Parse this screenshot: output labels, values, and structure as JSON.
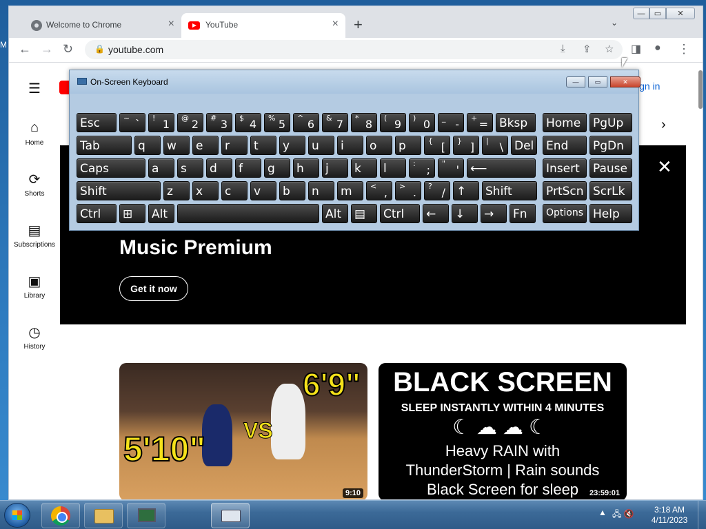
{
  "desktop": {
    "edge_text": "M"
  },
  "browser": {
    "tabs": [
      {
        "label": "Welcome to Chrome",
        "close": "×"
      },
      {
        "label": "YouTube",
        "close": "×"
      }
    ],
    "new_tab": "+",
    "tab_search": "⌄",
    "window_controls": {
      "min": "—",
      "max": "▭",
      "close": "✕"
    },
    "nav": {
      "back": "←",
      "forward": "→",
      "reload": "↻"
    },
    "address": {
      "lock": "🔒",
      "url": "youtube.com"
    },
    "omni_icons": {
      "install": "⤓",
      "share": "⇪",
      "bookmark": "☆"
    },
    "toolbar_icons": {
      "side_panel": "◨",
      "profile": "●",
      "menu": "⋮"
    }
  },
  "youtube": {
    "menu_icon": "☰",
    "sidebar": [
      {
        "icon": "⌂",
        "label": "Home"
      },
      {
        "icon": "⟳",
        "label": "Shorts"
      },
      {
        "icon": "▤",
        "label": "Subscriptions"
      },
      {
        "icon": "▣",
        "label": "Library"
      },
      {
        "icon": "◷",
        "label": "History"
      }
    ],
    "sign_in": "ign in",
    "chevron_right": "›",
    "banner": {
      "close": "✕",
      "title": "Music Premium",
      "button": "Get it now"
    },
    "videos": [
      {
        "duration": "9:10",
        "text_top": "6'9\"",
        "text_bottom": "5'10\"",
        "text_vs": "VS"
      },
      {
        "duration": "23:59:01",
        "title": "BLACK SCREEN",
        "subtitle": "SLEEP INSTANTLY WITHIN 4 MINUTES",
        "icons": "☾☁☁☾",
        "line1": "Heavy RAIN with",
        "line2": "ThunderStorm | Rain sounds",
        "line3": "Black Screen for sleep"
      }
    ]
  },
  "osk": {
    "title": "On-Screen Keyboard",
    "controls": {
      "min": "—",
      "max": "▭",
      "close": "✕"
    },
    "rows": [
      [
        {
          "main": "Esc"
        },
        {
          "shift": "~",
          "base": "`"
        },
        {
          "shift": "!",
          "base": "1"
        },
        {
          "shift": "@",
          "base": "2"
        },
        {
          "shift": "#",
          "base": "3"
        },
        {
          "shift": "$",
          "base": "4"
        },
        {
          "shift": "%",
          "base": "5"
        },
        {
          "shift": "^",
          "base": "6"
        },
        {
          "shift": "&",
          "base": "7"
        },
        {
          "shift": "*",
          "base": "8"
        },
        {
          "shift": "(",
          "base": "9"
        },
        {
          "shift": ")",
          "base": "0"
        },
        {
          "shift": "_",
          "base": "-"
        },
        {
          "shift": "+",
          "base": "="
        },
        {
          "main": "Bksp"
        },
        {
          "main": "Home"
        },
        {
          "main": "PgUp"
        }
      ],
      [
        {
          "main": "Tab"
        },
        {
          "main": "q"
        },
        {
          "main": "w"
        },
        {
          "main": "e"
        },
        {
          "main": "r"
        },
        {
          "main": "t"
        },
        {
          "main": "y"
        },
        {
          "main": "u"
        },
        {
          "main": "i"
        },
        {
          "main": "o"
        },
        {
          "main": "p"
        },
        {
          "shift": "{",
          "base": "["
        },
        {
          "shift": "}",
          "base": "]"
        },
        {
          "shift": "|",
          "base": "\\"
        },
        {
          "main": "Del"
        },
        {
          "main": "End"
        },
        {
          "main": "PgDn"
        }
      ],
      [
        {
          "main": "Caps"
        },
        {
          "main": "a"
        },
        {
          "main": "s"
        },
        {
          "main": "d"
        },
        {
          "main": "f"
        },
        {
          "main": "g"
        },
        {
          "main": "h"
        },
        {
          "main": "j"
        },
        {
          "main": "k"
        },
        {
          "main": "l"
        },
        {
          "shift": ":",
          "base": ";"
        },
        {
          "shift": "\"",
          "base": "'"
        },
        {
          "main": "⟵"
        },
        {
          "main": "Insert"
        },
        {
          "main": "Pause"
        }
      ],
      [
        {
          "main": "Shift"
        },
        {
          "main": "z"
        },
        {
          "main": "x"
        },
        {
          "main": "c"
        },
        {
          "main": "v"
        },
        {
          "main": "b"
        },
        {
          "main": "n"
        },
        {
          "main": "m"
        },
        {
          "shift": "<",
          "base": ","
        },
        {
          "shift": ">",
          "base": "."
        },
        {
          "shift": "?",
          "base": "/"
        },
        {
          "main": "↑"
        },
        {
          "main": "Shift"
        },
        {
          "main": "PrtScn"
        },
        {
          "main": "ScrLk"
        }
      ],
      [
        {
          "main": "Ctrl"
        },
        {
          "main": "⊞"
        },
        {
          "main": "Alt"
        },
        {
          "main": ""
        },
        {
          "main": "Alt"
        },
        {
          "main": "▤"
        },
        {
          "main": "Ctrl"
        },
        {
          "main": "←"
        },
        {
          "main": "↓"
        },
        {
          "main": "→"
        },
        {
          "main": "Fn"
        },
        {
          "main": "Options"
        },
        {
          "main": "Help"
        }
      ]
    ]
  },
  "taskbar": {
    "tray_arrow": "▲",
    "tray_icons": "🖧 🔇",
    "time": "3:18 AM",
    "date": "4/11/2023"
  },
  "colors": {
    "accent": "#065fd4",
    "brand_red": "#ff0000"
  }
}
